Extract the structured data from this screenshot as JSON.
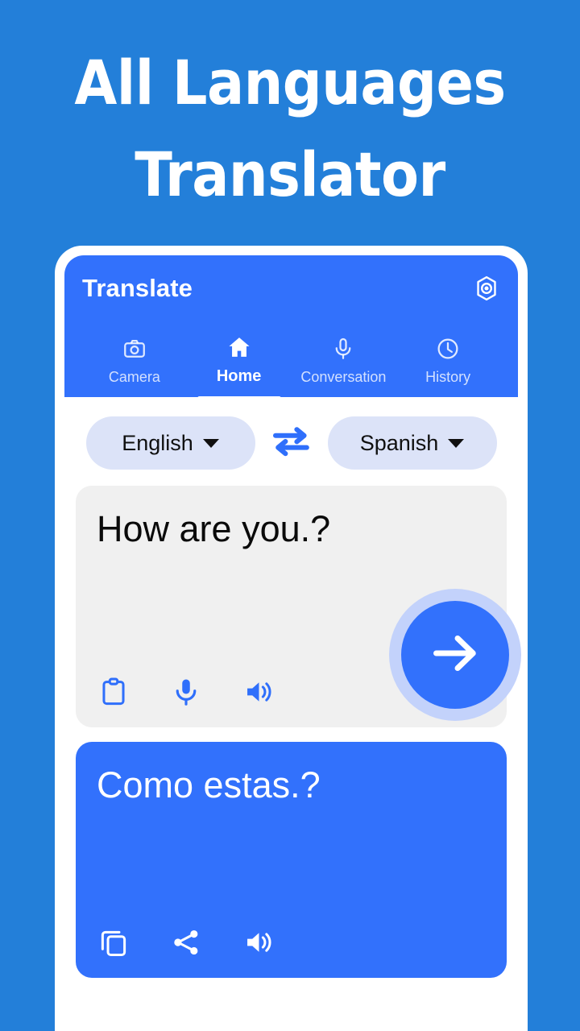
{
  "promo": {
    "headline": "All Languages\nTranslator",
    "background_color": "#237FD9",
    "text_color": "#FFFFFF"
  },
  "app": {
    "title": "Translate",
    "accent_color": "#3271FC",
    "settings_icon": "settings-hexagon-icon"
  },
  "tabs": [
    {
      "label": "Camera",
      "icon": "camera-icon",
      "active": false
    },
    {
      "label": "Home",
      "icon": "home-icon",
      "active": true
    },
    {
      "label": "Conversation",
      "icon": "microphone-icon",
      "active": false
    },
    {
      "label": "History",
      "icon": "clock-icon",
      "active": false
    }
  ],
  "language_selector": {
    "source_language": "English",
    "target_language": "Spanish",
    "swap_icon": "swap-arrows-icon",
    "chip_color": "#DCE3F8",
    "swap_color": "#3271FC"
  },
  "input_card": {
    "text": "How are you.?",
    "background_color": "#F0F0F0",
    "text_color": "#0A0A0A",
    "actions": [
      {
        "name": "paste-icon",
        "label": "Paste"
      },
      {
        "name": "microphone-icon",
        "label": "Speak"
      },
      {
        "name": "speaker-icon",
        "label": "Listen"
      }
    ],
    "translate_button": {
      "icon": "arrow-right-icon",
      "color": "#3271FC",
      "halo_color": "#C3D2FB"
    }
  },
  "output_card": {
    "text": "Como estas.?",
    "background_color": "#3271FC",
    "text_color": "#FFFFFF",
    "actions": [
      {
        "name": "copy-icon",
        "label": "Copy"
      },
      {
        "name": "share-icon",
        "label": "Share"
      },
      {
        "name": "speaker-icon",
        "label": "Listen"
      }
    ]
  }
}
